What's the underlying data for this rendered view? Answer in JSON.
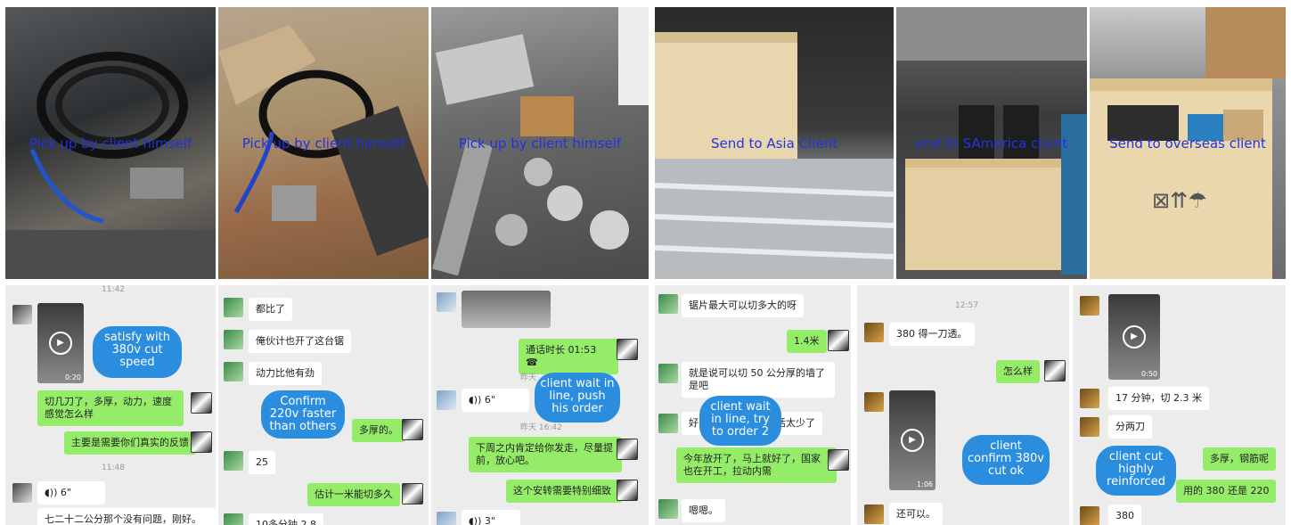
{
  "captions": [
    "Pick up by client himself",
    "Pick up by client himself",
    "Pick up by client himself",
    "Send to Asia Client",
    "end to SAmerica client",
    "Send to overseas client"
  ],
  "chat1": {
    "time_top": "11:42",
    "annotation": "satisfy with 380v cut speed",
    "video_dur": "0:20",
    "msg1": "切几刀了，多厚，动力，速度感觉怎么样",
    "msg2": "主要是需要你们真实的反馈",
    "time2": "11:48",
    "voice": "6\"",
    "msg3": "七二十二公分那个没有问题，刚好。"
  },
  "chat2": {
    "msg1": "都比了",
    "msg2": "俺伙计也开了这台锯",
    "msg3": "动力比他有劲",
    "annotation": "Confirm 220v faster than others",
    "msg4": "多厚的。",
    "msg5": "25",
    "msg6": "估计一米能切多久",
    "msg7": "10多分钟 2.8"
  },
  "chat3": {
    "call": "通话时长 01:53",
    "time1": "昨天",
    "annotation": "client wait in line, push his order",
    "voice1": "6\"",
    "time2": "昨天 16:42",
    "msg1": "下周之内肯定给你发走，尽量提前，放心吧。",
    "msg2": "这个安转需要特别细致",
    "voice2": "3\""
  },
  "chat4": {
    "msg1": "锯片最大可以切多大的呀",
    "msg2": "1.4米",
    "msg3": "就是说可以切 50 公分厚的墙了是吧",
    "msg4a": "好",
    "msg4b": "活太少了",
    "annotation": "client wait in line, try to order 2",
    "msg5": "今年放开了，马上就好了，国家也在开工，拉动内需",
    "msg6": "嗯嗯。"
  },
  "chat5": {
    "time": "12:57",
    "msg1": "380 得一刀透。",
    "msg2": "怎么样",
    "video_dur": "1:06",
    "annotation": "client confirm 380v cut ok",
    "msg3": "还可以。"
  },
  "chat6": {
    "video_dur": "0:50",
    "msg1": "17 分钟，切 2.3 米",
    "msg2": "分两刀",
    "annotation": "client cut highly reinforced",
    "msg3": "多厚，钢筋呢",
    "msg4": "用的 380 还是 220",
    "msg5": "380"
  }
}
